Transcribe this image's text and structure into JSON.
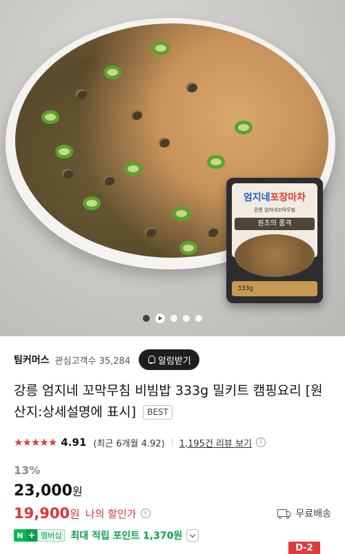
{
  "package": {
    "brand_part1": "엄지네",
    "brand_part2": "포장마차",
    "subtitle": "강릉 엄지네꼬막무침",
    "name": "원조의 품격",
    "weight": "333g"
  },
  "carousel": {
    "active_index": 0,
    "dot_count": 5
  },
  "seller": {
    "name": "팀커머스",
    "followers_label": "관심고객수 35,284",
    "alarm_button": "알림받기"
  },
  "product": {
    "title": "강릉 엄지네 꼬막무침 비빔밥 333g 밀키트 캠핑요리 [원산지:상세설명에 표시]",
    "badge": "BEST"
  },
  "rating": {
    "stars": "★★★★★",
    "stars_value": 4.91,
    "score": "4.91",
    "recent": "(최근 6개월 4.92)",
    "reviews_link": "1,195건 리뷰 보기",
    "info_icon": "i"
  },
  "price": {
    "discount": "13%",
    "original": "23,000",
    "currency": "원",
    "my_price": "19,900",
    "my_price_label": "나의 할인가",
    "shipping": "무료배송"
  },
  "membership": {
    "n_label": "N",
    "plus_label": "+",
    "member_label": "멤버십",
    "points_text": "최대 적립 포인트 1,370원"
  },
  "dday_badge": "D-2",
  "colors": {
    "accent_red": "#e0333b",
    "naver_green": "#07b853",
    "dark_button": "#1f1f21"
  }
}
